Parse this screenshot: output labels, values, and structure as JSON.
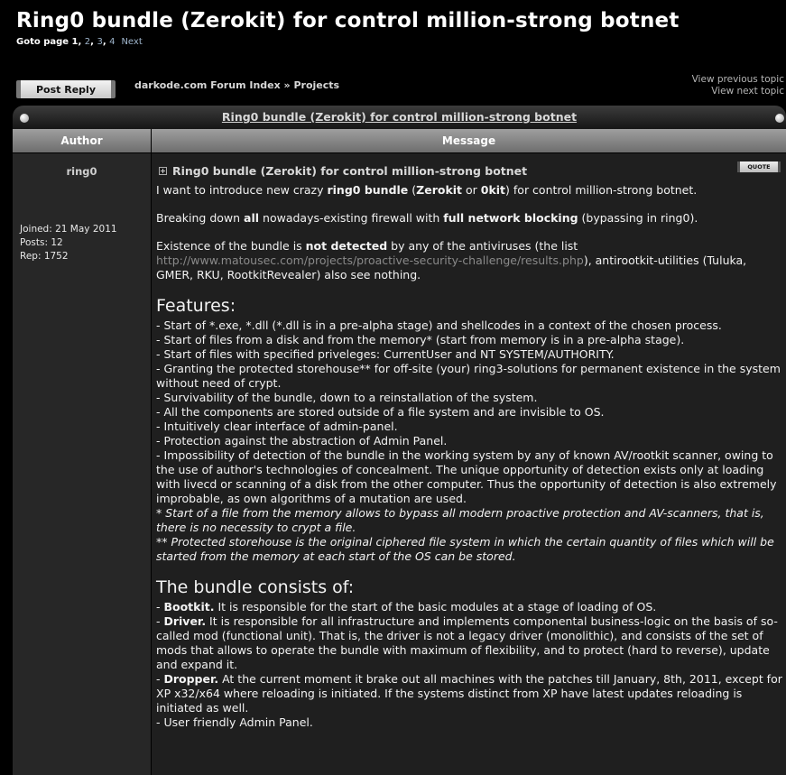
{
  "topic": {
    "title": "Ring0 bundle (Zerokit) for control million-strong botnet",
    "goto_label": "Goto page",
    "pages": [
      "1",
      "2",
      "3",
      "4"
    ],
    "next_label": "Next"
  },
  "toolbar": {
    "post_reply_label": "Post Reply",
    "breadcrumb": "darkode.com Forum Index » Projects",
    "prev_topic": "View previous topic",
    "next_topic": "View next topic"
  },
  "title_bar": "Ring0 bundle (Zerokit) for control million-strong botnet",
  "columns": {
    "author": "Author",
    "message": "Message"
  },
  "author": {
    "name": "ring0",
    "joined": "Joined: 21 May 2011",
    "posts": "Posts: 12",
    "rep": "Rep: 1752"
  },
  "post": {
    "subject": "Ring0 bundle (Zerokit) for control million-strong botnet",
    "quote_label": "QUOTE",
    "intro_a": "I want to introduce new crazy ",
    "intro_b": "ring0 bundle",
    "intro_c": " (",
    "intro_d": "Zerokit",
    "intro_e": " or ",
    "intro_f": "0kit",
    "intro_g": ") for control million-strong botnet.",
    "p2_a": "Breaking down ",
    "p2_b": "all",
    "p2_c": " nowadays-existing firewall with ",
    "p2_d": "full network blocking",
    "p2_e": " (bypassing in ring0).",
    "p3_a": "Existence of the bundle is ",
    "p3_b": "not detected",
    "p3_c": " by any of the antiviruses (the list ",
    "p3_link": "http://www.matousec.com/projects/proactive-security-challenge/results.php",
    "p3_d": "), antirootkit-utilities (Tuluka, GMER, RKU, RootkitRevealer) also see nothing.",
    "features_heading": "Features:",
    "features": [
      "- Start of *.exe, *.dll (*.dll is in a pre-alpha stage) and shellcodes in a context of the chosen process.",
      "- Start of files from a disk and from the memory* (start from memory is in a pre-alpha stage).",
      "- Start of files with specified priveleges: CurrentUser and NT SYSTEM/AUTHORITY.",
      "- Granting the protected storehouse** for off-site (your) ring3-solutions for permanent existence in the system without need of crypt.",
      "- Survivability of the bundle, down to a reinstallation of the system.",
      "- All the components are stored outside of a file system and are invisible to OS.",
      "- Intuitively clear interface of admin-panel.",
      "- Protection against the abstraction of Admin Panel.",
      "- Impossibility of detection of the bundle in the working system by any of known AV/rootkit scanner, owing to the use of author's technologies of concealment. The unique opportunity of detection exists only at loading with livecd or scanning of a disk from the other computer. Thus the opportunity of detection is also extremely improbable, as own algorithms of a mutation are used."
    ],
    "note1": "* Start of a file from the memory allows to bypass all modern proactive protection and AV-scanners, that is, there is no necessity to crypt a file.",
    "note2": "** Protected storehouse is the original ciphered file system in which the certain quantity of files which will be started from the memory at each start of the OS can be stored.",
    "bundle_heading": "The bundle consists of:",
    "b1_label": "Bootkit.",
    "b1_text": " It is responsible for the start of the basic modules at a stage of loading of OS.",
    "b2_label": "Driver.",
    "b2_text": " It is responsible for all infrastructure and implements componental business-logic on the basis of so-called mod (functional unit). That is, the driver is not a legacy driver (monolithic), and consists of the set of mods that allows to operate the bundle with maximum of flexibility, and to protect (hard to reverse), update and expand it.",
    "b3_label": "Dropper.",
    "b3_text": " At the current moment it brake out all machines with the patches till January, 8th, 2011, except for XP x32/x64 where reloading is initiated. If the systems distinct from XP have latest updates reloading is initiated as well.",
    "b4_text": "- User friendly Admin Panel."
  }
}
